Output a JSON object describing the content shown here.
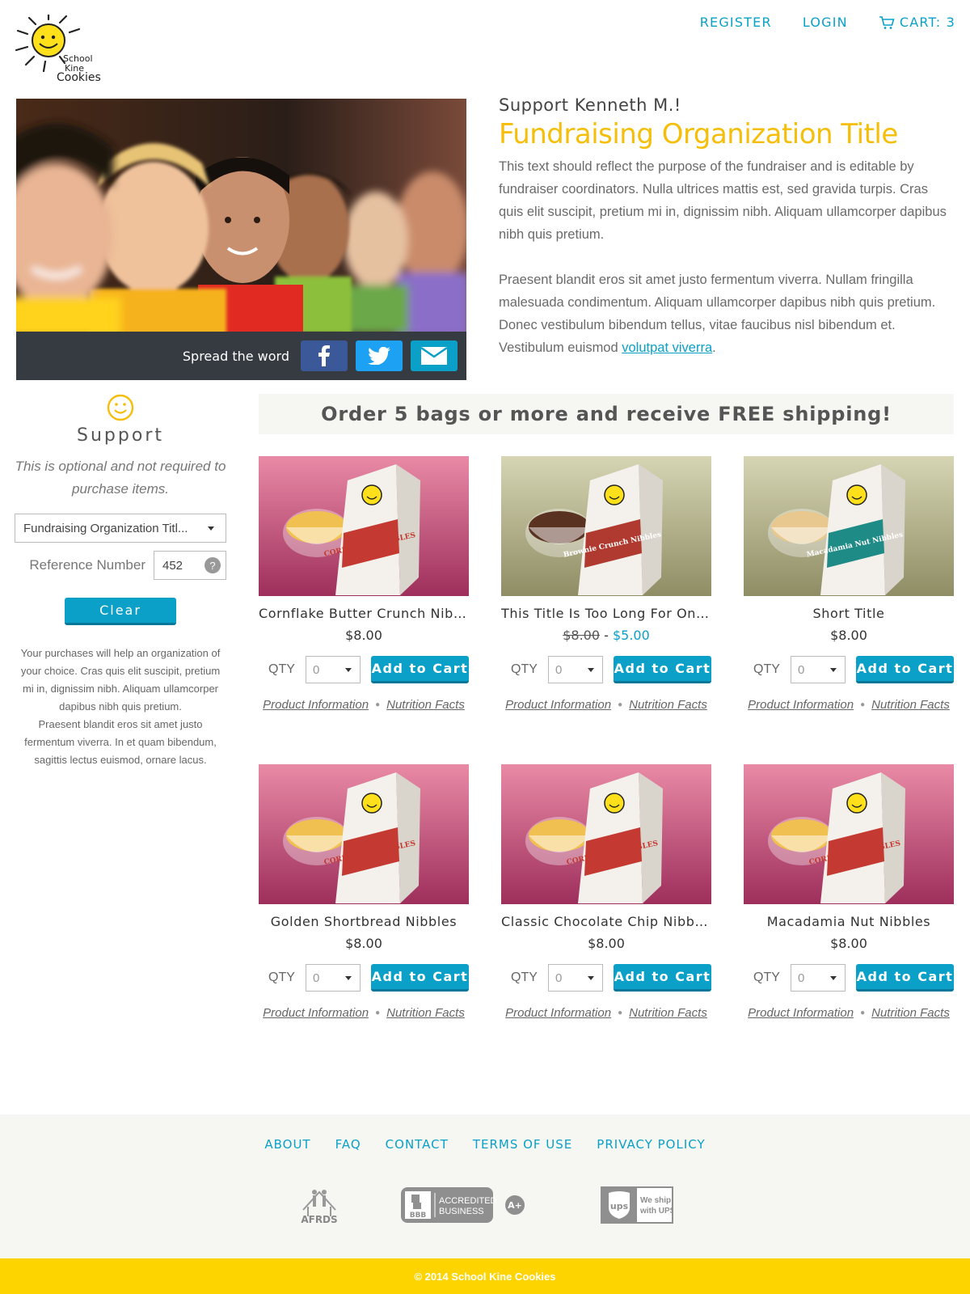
{
  "brand": {
    "logo_line1": "School",
    "logo_line2": "Kine",
    "logo_line3": "Cookies",
    "accent": "#0aa0c8",
    "yellow": "#f5be0a"
  },
  "topnav": {
    "register": "REGISTER",
    "login": "LOGIN",
    "cart": "CART: 3"
  },
  "hero": {
    "share_label": "Spread the word",
    "support_heading": "Support Kenneth M.!",
    "org_title": "Fundraising Organization Title",
    "para1": "This text should reflect the purpose of the fundraiser and is editable by fundraiser coordinators. Nulla ultrices mattis est, sed gravida turpis. Cras quis elit suscipit, pretium mi in, dignissim nibh. Aliquam ullamcorper dapibus nibh quis pretium.",
    "para2": "Praesent blandit eros sit amet justo fermentum viverra.  Nullam fringilla malesuada condimentum. Aliquam ullamcorper dapibus nibh quis pretium. Donec vestibulum bibendum tellus, vitae faucibus nisl bibendum et. Vestibulum euismod ",
    "para2_link": "volutpat viverra",
    "para2_end": "."
  },
  "sidebar": {
    "title": "Support",
    "note": "This is optional and not required to purchase items.",
    "org_select": "Fundraising Organization Titl...",
    "ref_label": "Reference Number",
    "ref_value": "452",
    "help": "?",
    "clear": "Clear",
    "body1": "Your purchases will help an organization of your choice. Cras quis elit suscipit, pretium mi in, dignissim nibh. Aliquam ullamcorper dapibus nibh quis pretium.",
    "body2": "Praesent blandit eros sit amet justo fermentum viverra. In et quam bibendum, sagittis lectus euismod, ornare lacus."
  },
  "banner": "Order 5 bags or more and receive FREE shipping!",
  "product_common": {
    "qty_label": "QTY",
    "qty_value": "0",
    "add_label": "Add to Cart",
    "info_link": "Product Information",
    "nutrition_link": "Nutrition Facts"
  },
  "products": [
    {
      "title": "Cornflake Butter Crunch Nibbles",
      "price": "$8.00",
      "bag_label": "CORNFLAKE NIBBLES",
      "theme": "cornflake"
    },
    {
      "title": "This Title Is Too Long For One L...",
      "price_old": "$8.00",
      "price_sep": " - ",
      "price": "$5.00",
      "bag_label": "Brownie Crunch Nibbles",
      "theme": "brownie"
    },
    {
      "title": "Short Title",
      "price": "$8.00",
      "bag_label": "Macadamia Nut Nibbles",
      "theme": "macadamia"
    },
    {
      "title": "Golden Shortbread Nibbles",
      "price": "$8.00",
      "bag_label": "CORNFLAKE NIBBLES",
      "theme": "cornflake"
    },
    {
      "title": "Classic Chocolate Chip Nibbles",
      "price": "$8.00",
      "bag_label": "CORNFLAKE NIBBLES",
      "theme": "cornflake"
    },
    {
      "title": "Macadamia Nut Nibbles",
      "price": "$8.00",
      "bag_label": "CORNFLAKE NIBBLES",
      "theme": "cornflake"
    }
  ],
  "footer": {
    "nav": [
      "ABOUT",
      "FAQ",
      "CONTACT",
      "TERMS OF USE",
      "PRIVACY POLICY"
    ],
    "afrds": "AFRDS",
    "bbb": "BBB",
    "bbb_text1": "ACCREDITED",
    "bbb_text2": "BUSINESS",
    "bbb_rating": "A+",
    "ups": "ups",
    "ups_text1": "We ship",
    "ups_text2": "with UPS",
    "copyright": "© 2014 School Kine Cookies"
  }
}
